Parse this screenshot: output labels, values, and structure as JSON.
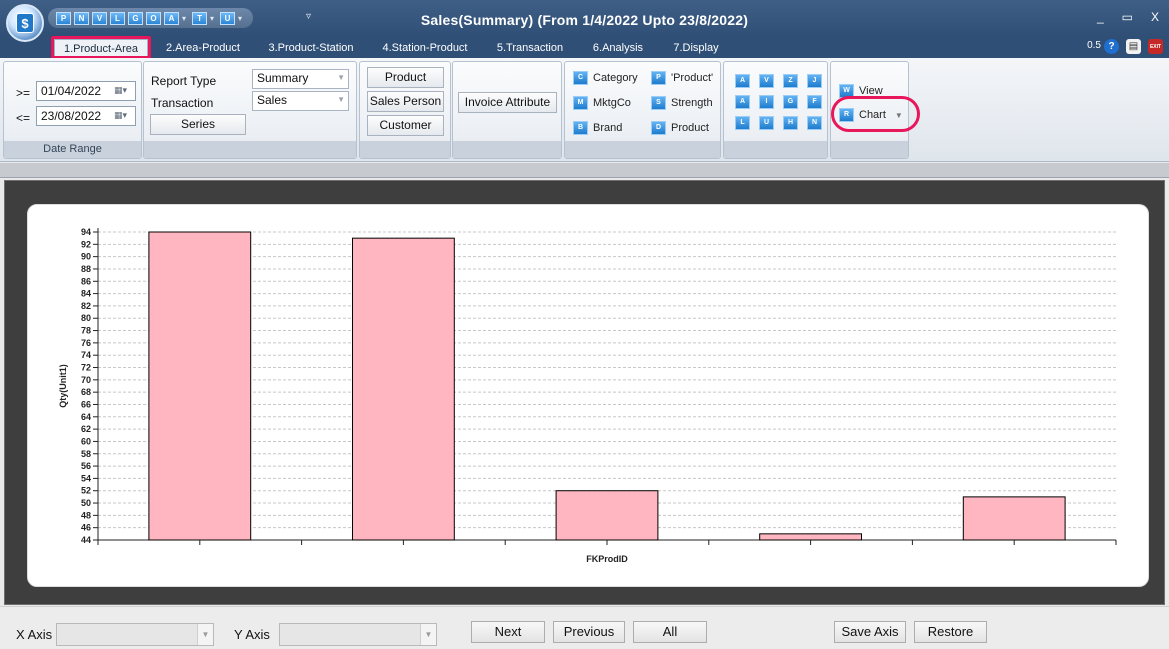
{
  "window": {
    "title": "Sales(Summary) (From 1/4/2022 Upto 23/8/2022)",
    "controls": {
      "minimize": "_",
      "restore": "▭",
      "close": "X"
    }
  },
  "quick_access": {
    "buttons": [
      "P",
      "N",
      "V",
      "L",
      "G",
      "O",
      "A",
      "T",
      "U"
    ],
    "overflow": "▿"
  },
  "tabs": [
    {
      "label": "1.Product-Area",
      "active": true
    },
    {
      "label": "2.Area-Product"
    },
    {
      "label": "3.Product-Station"
    },
    {
      "label": "4.Station-Product"
    },
    {
      "label": "5.Transaction"
    },
    {
      "label": "6.Analysis"
    },
    {
      "label": "7.Display"
    }
  ],
  "topright": {
    "version": "0.5",
    "help_icon": "?",
    "doc_icon": "▤",
    "exit_icon": "EXIT"
  },
  "ribbon": {
    "date_range": {
      "from_op": ">=",
      "from_date": "01/04/2022",
      "to_op": "<=",
      "to_date": "23/08/2022",
      "caption": "Date Range"
    },
    "report": {
      "report_type_label": "Report Type",
      "report_type_value": "Summary",
      "transaction_label": "Transaction",
      "transaction_value": "Sales",
      "series_button": "Series"
    },
    "dimensions": {
      "product": "Product",
      "sales_person": "Sales Person",
      "customer": "Customer"
    },
    "invoice_attribute": "Invoice Attribute",
    "filters": {
      "category": "Category",
      "product_quoted": "'Product'",
      "mktgco": "MktgCo",
      "strength": "Strength",
      "brand": "Brand",
      "product": "Product"
    },
    "view": {
      "view_label": "View",
      "chart_label": "Chart"
    }
  },
  "footer": {
    "x_axis_label": "X Axis",
    "y_axis_label": "Y Axis",
    "next": "Next",
    "previous": "Previous",
    "all": "All",
    "save_axis": "Save Axis",
    "restore": "Restore"
  },
  "colors": {
    "bar_fill": "#ffb6c1",
    "highlight": "#e8165a",
    "titlebar": "#2f4f76"
  },
  "chart_data": {
    "type": "bar",
    "xlabel": "FKProdID",
    "ylabel": "Qty(Unit1)",
    "ylim": [
      44,
      94
    ],
    "yticks": [
      44,
      46,
      48,
      50,
      52,
      54,
      56,
      58,
      60,
      62,
      64,
      66,
      68,
      70,
      72,
      74,
      76,
      78,
      80,
      82,
      84,
      86,
      88,
      90,
      92,
      94
    ],
    "values": [
      94,
      93,
      52,
      45,
      51
    ],
    "grid": true,
    "grid_style": "dashed"
  }
}
